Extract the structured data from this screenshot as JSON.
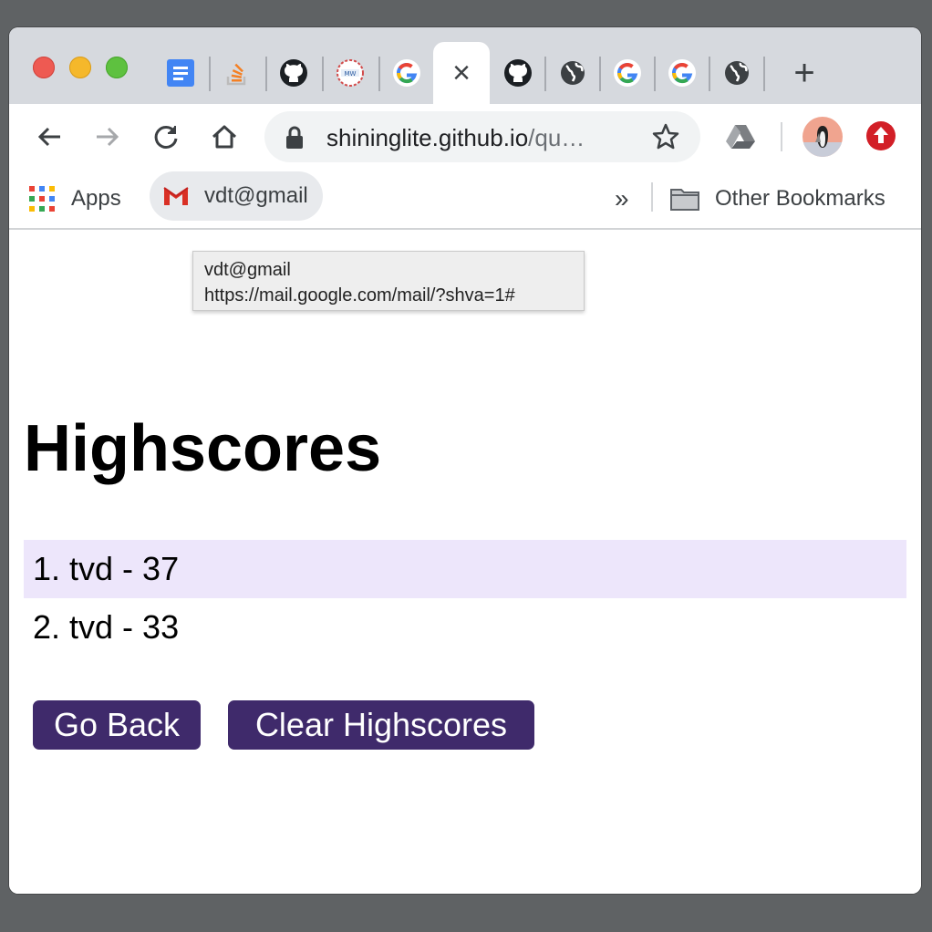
{
  "browser": {
    "tabs": [
      {
        "icon": "google-docs-icon"
      },
      {
        "icon": "stackoverflow-icon"
      },
      {
        "icon": "github-icon"
      },
      {
        "icon": "site-logo-icon"
      },
      {
        "icon": "google-icon"
      },
      {
        "icon": "close-icon",
        "active": true,
        "close_glyph": "×"
      },
      {
        "icon": "github-icon"
      },
      {
        "icon": "globe-icon"
      },
      {
        "icon": "google-icon"
      },
      {
        "icon": "google-icon"
      },
      {
        "icon": "globe-icon"
      }
    ],
    "new_tab_glyph": "+",
    "address_bar": {
      "host": "shininglite.github.io",
      "path": "/qu…"
    },
    "bookmarks": {
      "apps_label": "Apps",
      "gmail_label": "vdt@gmail",
      "more_glyph": "»",
      "other_label": "Other Bookmarks"
    },
    "tooltip": {
      "title": "vdt@gmail",
      "url": "https://mail.google.com/mail/?shva=1#"
    }
  },
  "page": {
    "heading": "Highscores",
    "scores": [
      {
        "text": "1. tvd - 37"
      },
      {
        "text": "2. tvd - 33"
      }
    ],
    "buttons": {
      "go_back": "Go Back",
      "clear": "Clear Highscores"
    }
  },
  "colors": {
    "button_bg": "#3f2a6b",
    "row_highlight": "#ede6fb",
    "update_badge": "#d21f27"
  }
}
